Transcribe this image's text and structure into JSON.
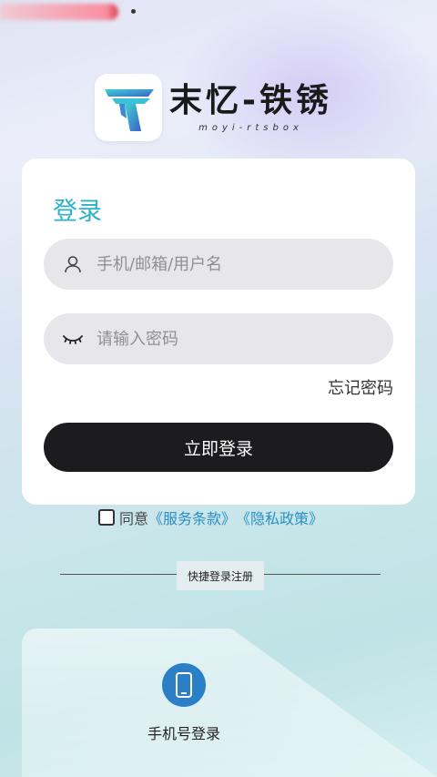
{
  "brand": {
    "name_cn": "末忆-铁锈",
    "name_en": "moyi-rtsbox"
  },
  "login": {
    "title": "登录",
    "username_placeholder": "手机/邮箱/用户名",
    "password_placeholder": "请输入密码",
    "forgot_password": "忘记密码",
    "submit_label": "立即登录"
  },
  "agreement": {
    "prefix": "同意",
    "terms_link": "《服务条款》",
    "privacy_link": "《隐私政策》"
  },
  "quick": {
    "divider_label": "快捷登录注册",
    "phone_login_label": "手机号登录"
  },
  "colors": {
    "accent": "#2bb2c8",
    "link": "#2a8fc4",
    "button": "#1c1c1e",
    "phone_icon_bg": "#2a7fc7"
  },
  "icons": {
    "username": "person-icon",
    "password": "closed-eye-icon",
    "phone": "mobile-phone-icon"
  }
}
